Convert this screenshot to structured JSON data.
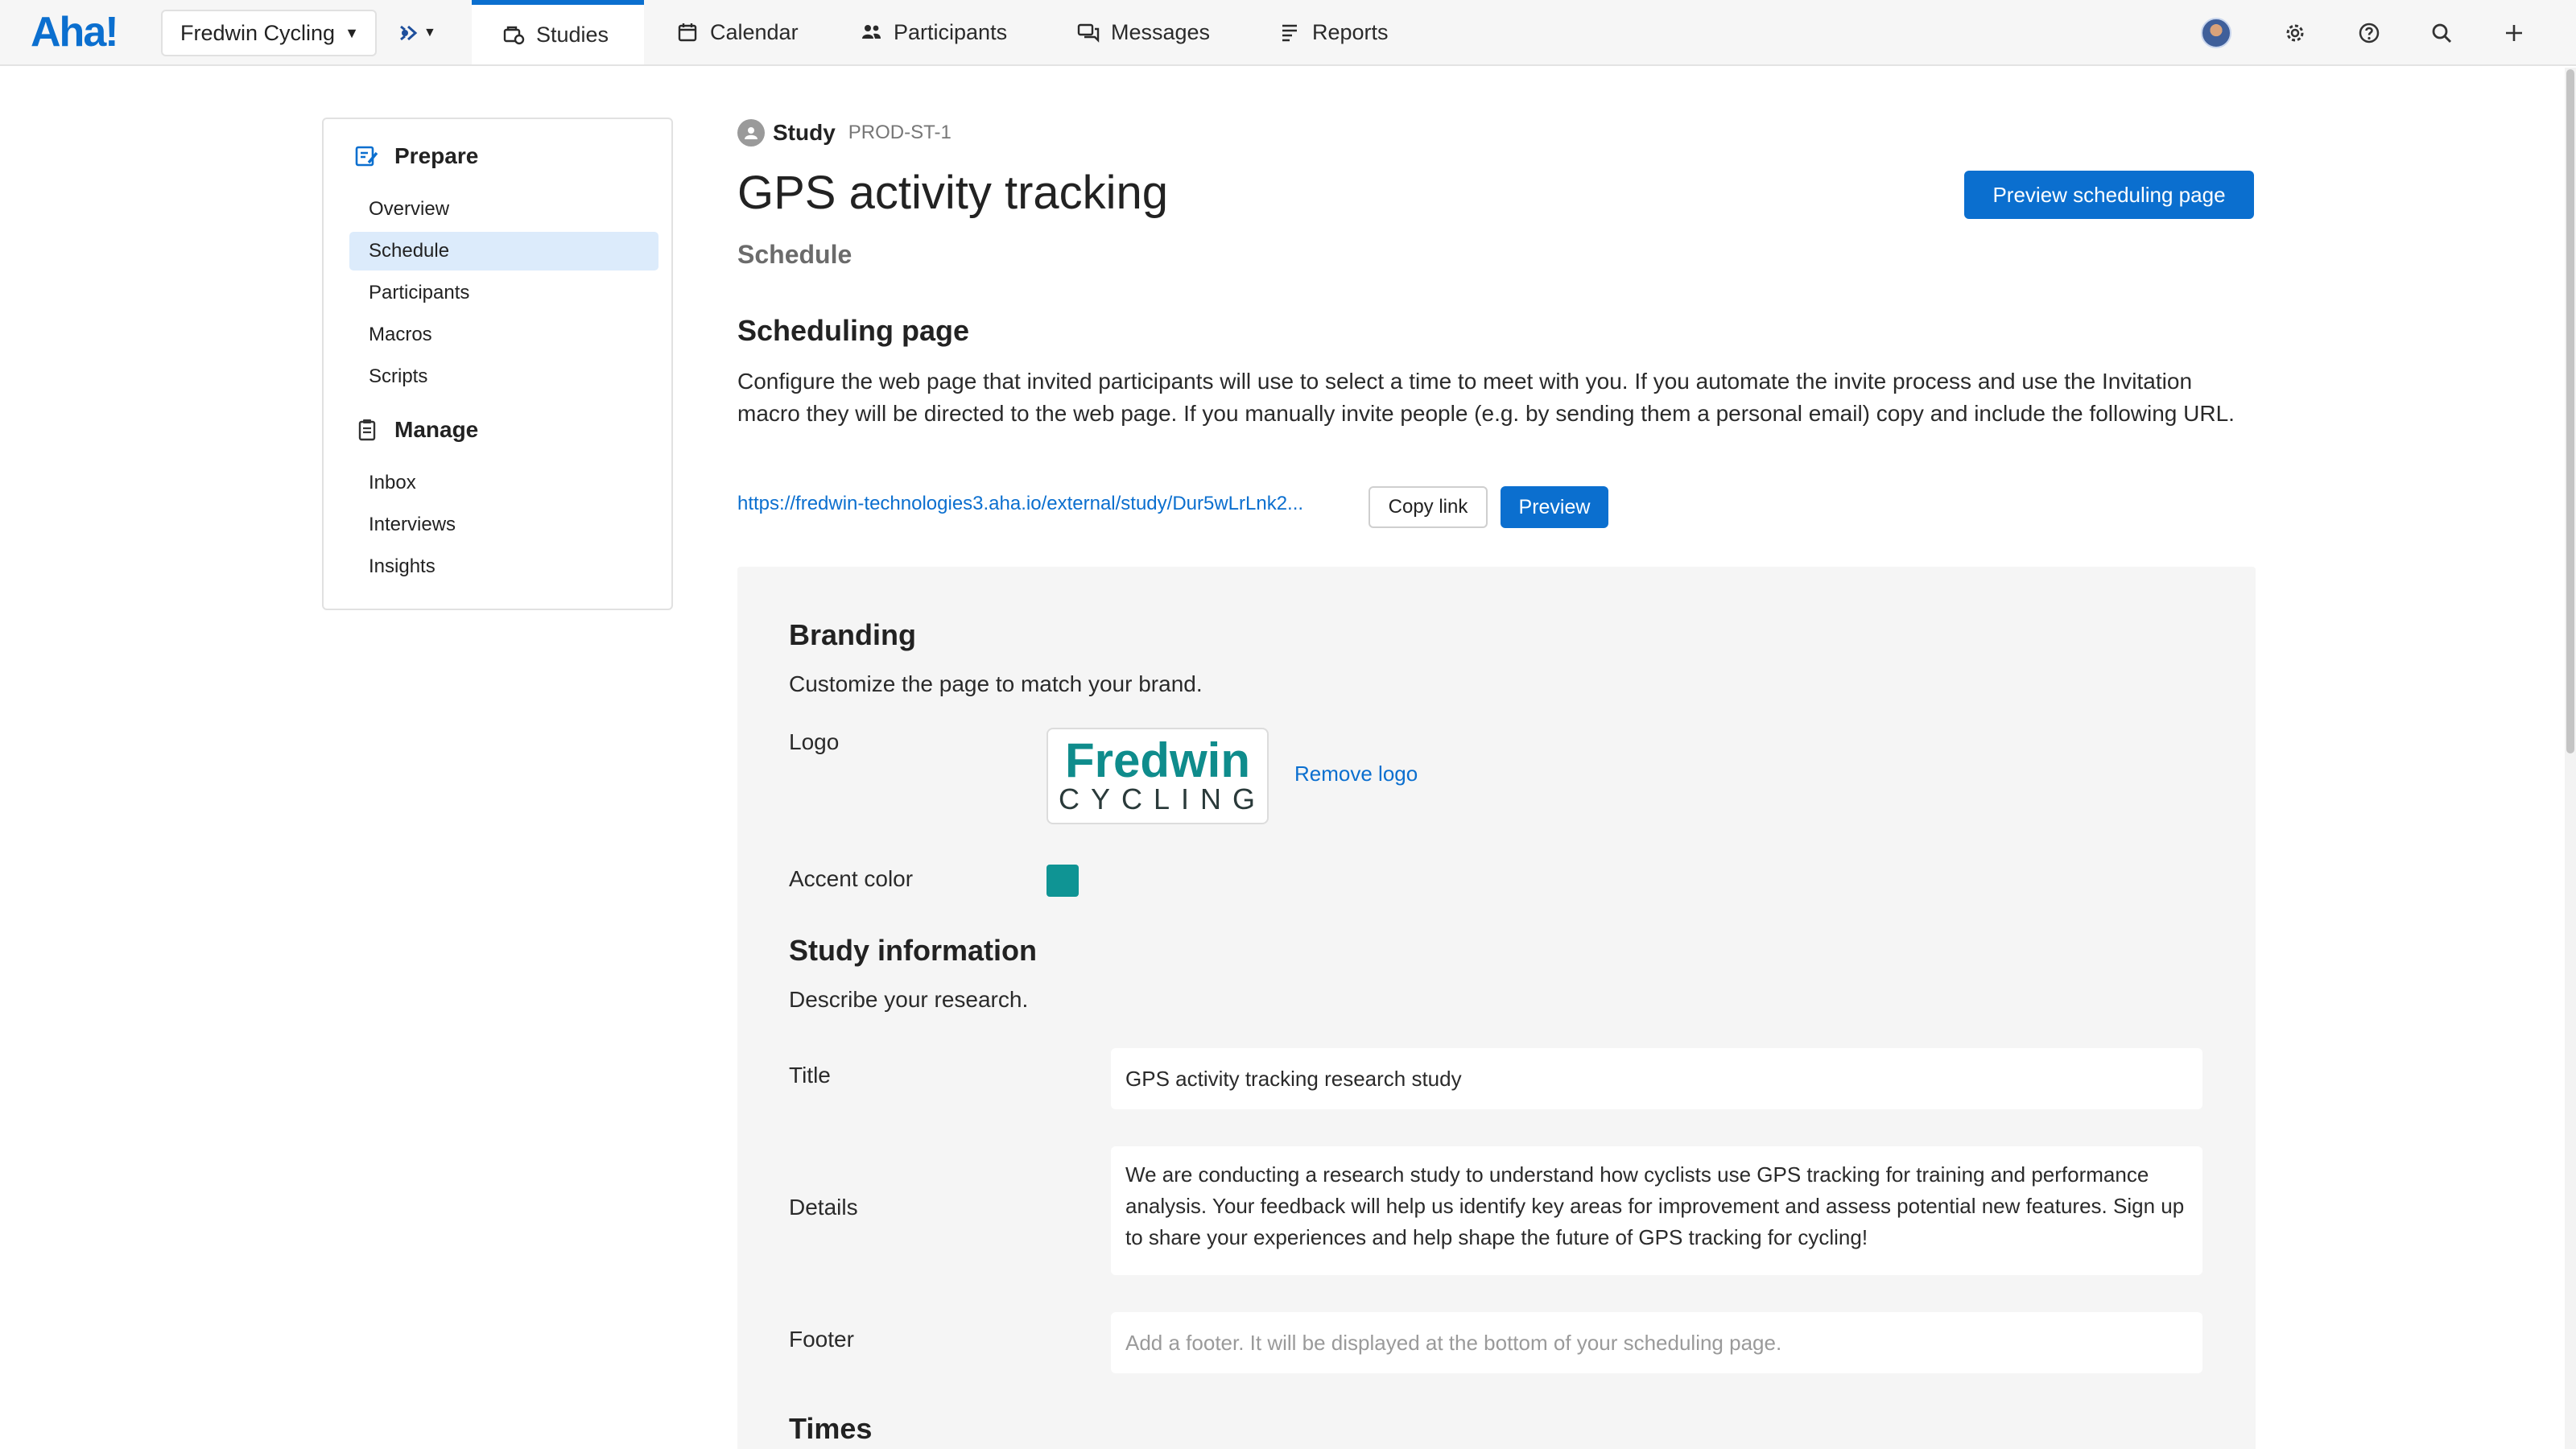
{
  "topbar": {
    "logo": "Aha!",
    "workspace": "Fredwin Cycling",
    "tabs": [
      {
        "label": "Studies",
        "icon": "studies-icon"
      },
      {
        "label": "Calendar",
        "icon": "calendar-icon"
      },
      {
        "label": "Participants",
        "icon": "participants-icon"
      },
      {
        "label": "Messages",
        "icon": "messages-icon"
      },
      {
        "label": "Reports",
        "icon": "reports-icon"
      }
    ],
    "active_tab": "Studies",
    "accent": "#0b6fcf"
  },
  "sidebar": {
    "prepare_title": "Prepare",
    "prepare_items": [
      "Overview",
      "Schedule",
      "Participants",
      "Macros",
      "Scripts"
    ],
    "manage_title": "Manage",
    "manage_items": [
      "Inbox",
      "Interviews",
      "Insights"
    ],
    "active_item": "Schedule"
  },
  "header": {
    "record_type": "Study",
    "record_id": "PROD-ST-1",
    "title": "GPS activity tracking",
    "subtitle": "Schedule",
    "preview_scheduling_button": "Preview scheduling page"
  },
  "scheduling": {
    "heading": "Scheduling page",
    "description": "Configure the web page that invited participants will use to select a time to meet with you. If you automate the invite process and use the Invitation macro they will be directed to the web page. If you manually invite people (e.g. by sending them a personal email) copy and include the following URL.",
    "url": "https://fredwin-technologies3.aha.io/external/study/Dur5wLrLnk2...",
    "copy_link_button": "Copy link",
    "preview_button": "Preview"
  },
  "branding": {
    "heading": "Branding",
    "description": "Customize the page to match your brand.",
    "logo_label": "Logo",
    "logo_text_main": "Fredwin",
    "logo_text_sub": "CYCLING",
    "remove_logo": "Remove logo",
    "accent_label": "Accent color",
    "accent_color": "#0f9494"
  },
  "study_info": {
    "heading": "Study information",
    "description": "Describe your research.",
    "title_label": "Title",
    "title_value": "GPS activity tracking research study",
    "details_label": "Details",
    "details_value": "We are conducting a research study to understand how cyclists use GPS tracking for training and performance analysis. Your feedback will help us identify key areas for improvement and assess potential new features. Sign up to share your experiences and help shape the future of GPS tracking for cycling!",
    "footer_label": "Footer",
    "footer_placeholder": "Add a footer. It will be displayed at the bottom of your scheduling page."
  },
  "times": {
    "heading": "Times"
  }
}
